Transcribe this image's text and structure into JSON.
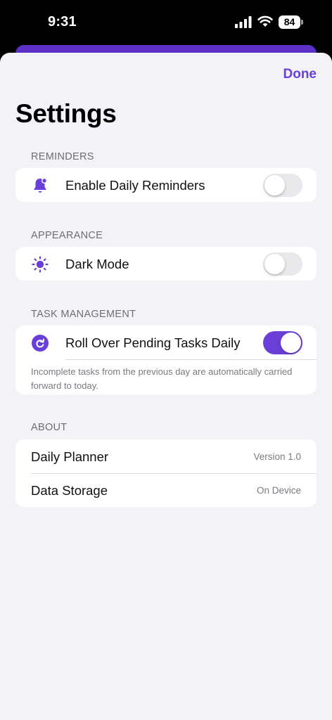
{
  "status_bar": {
    "time": "9:31",
    "battery": "84"
  },
  "header": {
    "done_label": "Done",
    "title": "Settings"
  },
  "sections": {
    "reminders": {
      "header": "REMINDERS",
      "row": {
        "icon": "bell-icon",
        "label": "Enable Daily Reminders",
        "enabled": false
      }
    },
    "appearance": {
      "header": "APPEARANCE",
      "row": {
        "icon": "sun-icon",
        "label": "Dark Mode",
        "enabled": false
      }
    },
    "task_management": {
      "header": "TASK MANAGEMENT",
      "row": {
        "icon": "rollover-icon",
        "label": "Roll Over Pending Tasks Daily",
        "enabled": true
      },
      "footnote": "Incomplete tasks from the previous day are automatically carried forward to today."
    },
    "about": {
      "header": "ABOUT",
      "rows": [
        {
          "label": "Daily Planner",
          "value": "Version 1.0"
        },
        {
          "label": "Data Storage",
          "value": "On Device"
        }
      ]
    }
  },
  "colors": {
    "accent": "#6a3fd7",
    "background": "#f2f2f7",
    "toggle_off": "#e9e9eb"
  }
}
